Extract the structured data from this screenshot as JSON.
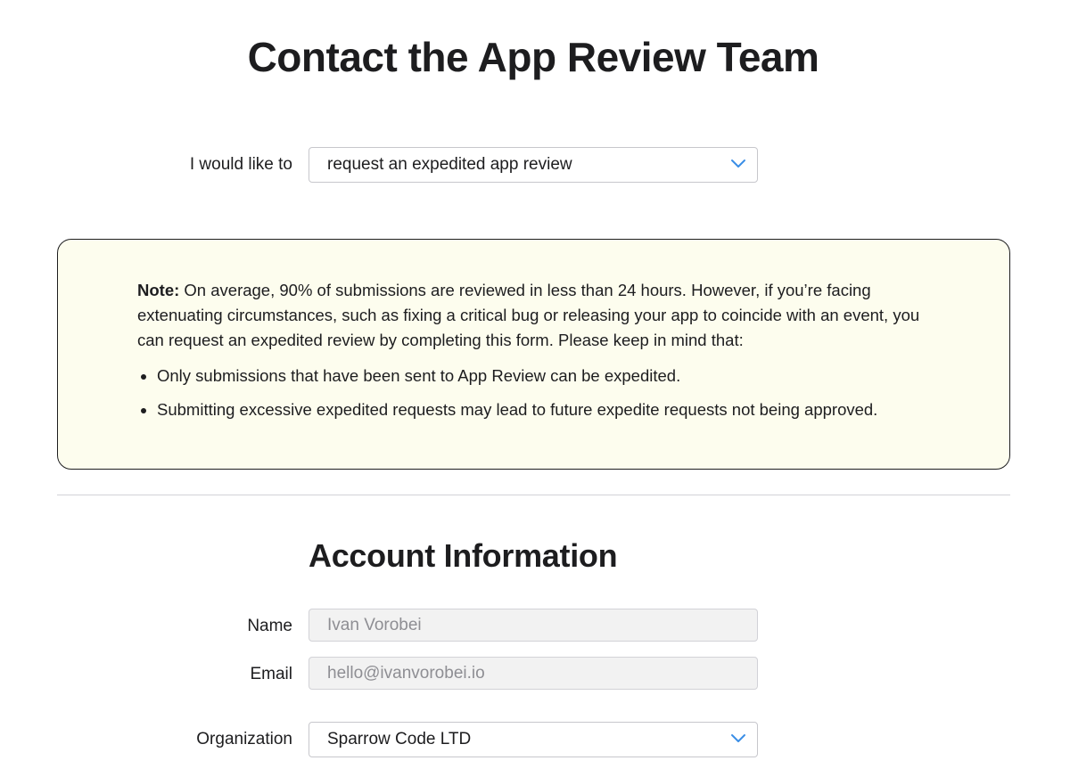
{
  "page": {
    "title": "Contact the App Review Team"
  },
  "request_type": {
    "label": "I would like to",
    "selected": "request an expedited app review"
  },
  "note": {
    "prefix": "Note:",
    "text": " On average, 90% of submissions are reviewed in less than 24 hours. However, if you’re facing extenuating circumstances, such as fixing a critical bug or releasing your app to coincide with an event, you can request an expedited review by completing this form. Please keep in mind that:",
    "bullets": [
      "Only submissions that have been sent to App Review can be expedited.",
      "Submitting excessive expedited requests may lead to future expedite requests not being approved."
    ]
  },
  "account": {
    "section_title": "Account Information",
    "name_label": "Name",
    "name_value": "Ivan Vorobei",
    "email_label": "Email",
    "email_value": "hello@ivanvorobei.io",
    "organization_label": "Organization",
    "organization_selected": "Sparrow Code LTD"
  },
  "colors": {
    "note_background": "#fdfdee",
    "chevron": "#3a8ee6",
    "disabled_field": "#f2f2f2",
    "text": "#1d1d1f"
  },
  "icons": {
    "dropdown": "chevron-down-icon"
  }
}
